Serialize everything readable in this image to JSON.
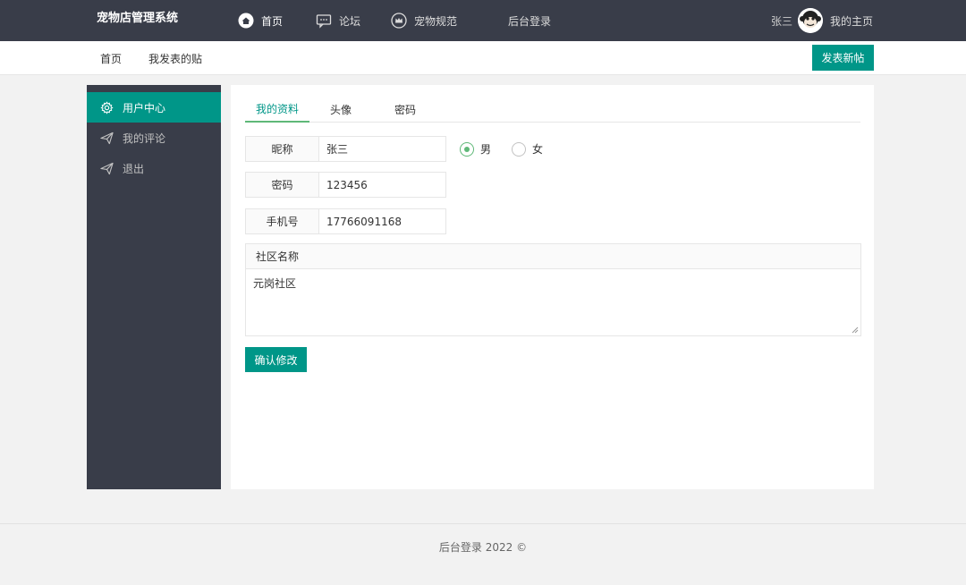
{
  "header": {
    "brand": "宠物店管理系统",
    "nav": {
      "home": "首页",
      "forum": "论坛",
      "rules": "宠物规范",
      "admin_login": "后台登录"
    },
    "user_name": "张三",
    "my_home": "我的主页"
  },
  "subbar": {
    "home": "首页",
    "my_posts": "我发表的贴",
    "new_post_button": "发表新帖"
  },
  "sidebar": {
    "items": [
      {
        "label": "用户中心",
        "icon": "gear-icon",
        "active": true
      },
      {
        "label": "我的评论",
        "icon": "paper-plane-icon",
        "active": false
      },
      {
        "label": "退出",
        "icon": "paper-plane-icon",
        "active": false
      }
    ]
  },
  "tabs": [
    "我的资料",
    "头像",
    "密码"
  ],
  "form": {
    "nickname_label": "昵称",
    "nickname_value": "张三",
    "password_label": "密码",
    "password_value": "123456",
    "phone_label": "手机号",
    "phone_value": "17766091168",
    "gender_options": [
      "男",
      "女"
    ],
    "gender_selected": "男",
    "community_label": "社区名称",
    "community_value": "元岗社区",
    "confirm_button": "确认修改"
  },
  "footer": {
    "text": "后台登录   2022 ©"
  },
  "colors": {
    "header_bg": "#393d49",
    "accent": "#009688",
    "radio_checked": "#5fb878"
  }
}
